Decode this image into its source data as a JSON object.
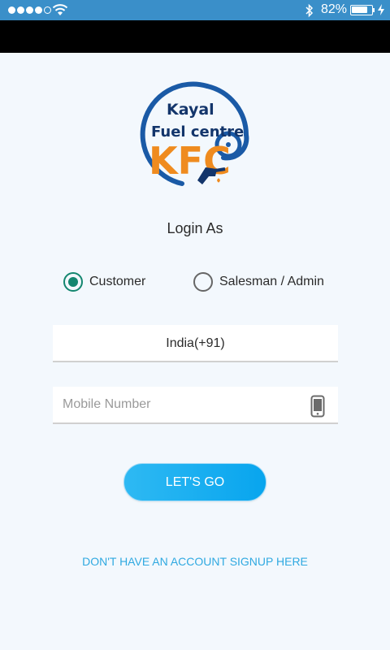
{
  "status_bar": {
    "battery_percent": "82%",
    "battery_level": 0.82,
    "signal_bars_filled": 4,
    "signal_bars_total": 5
  },
  "logo": {
    "line1": "Kayal",
    "line2": "Fuel centre",
    "initials": "KFC",
    "colors": {
      "blue": "#1a5aa6",
      "orange": "#ef8b1f",
      "navy": "#13356b"
    }
  },
  "login": {
    "title": "Login As",
    "options": [
      {
        "label": "Customer",
        "selected": true
      },
      {
        "label": "Salesman / Admin",
        "selected": false
      }
    ]
  },
  "form": {
    "country_value": "India(+91)",
    "mobile_placeholder": "Mobile Number",
    "mobile_value": "",
    "submit_label": "LET'S GO"
  },
  "footer": {
    "signup_link": "DON'T HAVE AN ACCOUNT SIGNUP HERE"
  },
  "colors": {
    "status_bar": "#3a8fc9",
    "background": "#f3f8fd",
    "radio_selected": "#13866f",
    "button": "#08a5ee",
    "link": "#2fa9e1"
  },
  "icons": [
    "bluetooth-icon",
    "wifi-icon",
    "battery-icon",
    "charging-icon",
    "mobile-phone-icon",
    "fuel-nozzle-icon"
  ]
}
